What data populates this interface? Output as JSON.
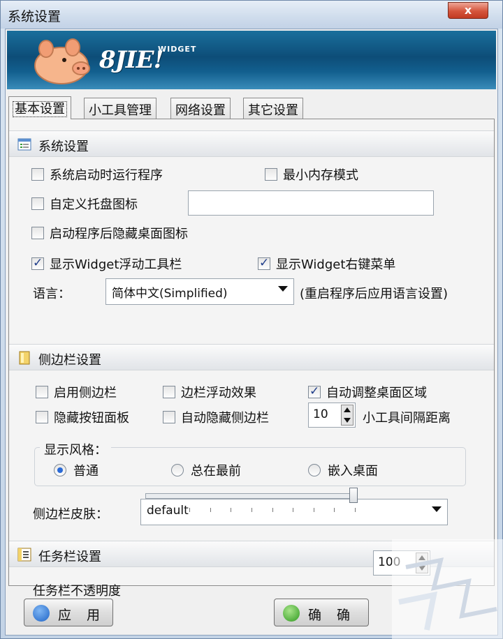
{
  "window": {
    "title": "系统设置",
    "close_label": "x"
  },
  "banner": {
    "logo_text": "8JIE!",
    "logo_sub": "WIDGET"
  },
  "tabs": [
    {
      "label": "基本设置",
      "active": true
    },
    {
      "label": "小工具管理",
      "active": false
    },
    {
      "label": "网络设置",
      "active": false
    },
    {
      "label": "其它设置",
      "active": false
    }
  ],
  "system": {
    "header": "系统设置",
    "run_on_startup": {
      "label": "系统启动时运行程序",
      "checked": false
    },
    "min_memory": {
      "label": "最小内存模式",
      "checked": false
    },
    "custom_tray_icon": {
      "label": "自定义托盘图标",
      "checked": false,
      "value": ""
    },
    "hide_desktop_icons": {
      "label": "启动程序后隐藏桌面图标",
      "checked": false
    },
    "show_float_toolbar": {
      "label": "显示Widget浮动工具栏",
      "checked": true
    },
    "show_context_menu": {
      "label": "显示Widget右键菜单",
      "checked": true
    },
    "language_label": "语言：",
    "language_value": "简体中文(Simplified)",
    "language_note": "(重启程序后应用语言设置)"
  },
  "sidebar": {
    "header": "侧边栏设置",
    "enable": {
      "label": "启用侧边栏",
      "checked": false
    },
    "float_effect": {
      "label": "边栏浮动效果",
      "checked": false
    },
    "auto_adjust": {
      "label": "自动调整桌面区域",
      "checked": true
    },
    "hide_button_panel": {
      "label": "隐藏按钮面板",
      "checked": false
    },
    "auto_hide": {
      "label": "自动隐藏侧边栏",
      "checked": false
    },
    "spacing_value": "10",
    "spacing_label": "小工具间隔距离",
    "style_group_title": "显示风格：",
    "style_options": [
      {
        "label": "普通",
        "selected": true
      },
      {
        "label": "总在最前",
        "selected": false
      },
      {
        "label": "嵌入桌面",
        "selected": false
      }
    ],
    "skin_label": "侧边栏皮肤：",
    "skin_value": "default"
  },
  "taskbar": {
    "header": "任务栏设置",
    "opacity_label": "任务栏不透明度",
    "opacity_value": "100",
    "opacity_fraction": 1.0
  },
  "buttons": {
    "apply": "应 用",
    "ok": "确 确"
  },
  "colors": {
    "banner": "#0d4d78",
    "accent_check": "#1f3d8a",
    "radio_dot": "#2a6ad6"
  }
}
